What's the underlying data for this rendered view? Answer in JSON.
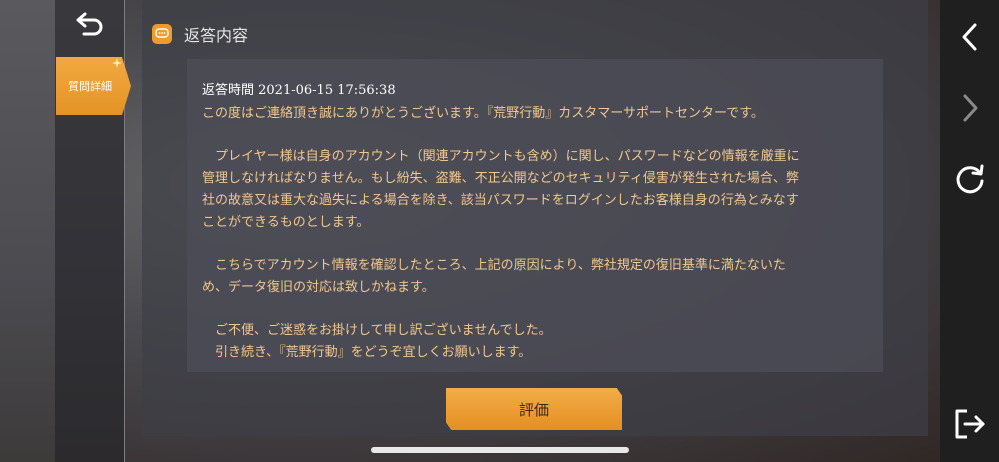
{
  "sidebar": {
    "tab_label": "質問詳細"
  },
  "header": {
    "title": "返答内容"
  },
  "reply": {
    "time": "返答時間 2021-06-15 17:56:38",
    "para1": "この度はご連絡頂き誠にありがとうございます。『荒野行動』カスタマーサポートセンターです。",
    "para2_line1": "　プレイヤー様は自身のアカウント（関連アカウントも含め）に関し、パスワードなどの情報を厳重に",
    "para2_line2": "管理しなければなりません。もし紛失、盗難、不正公開などのセキュリティ侵害が発生された場合、弊",
    "para2_line3": "社の故意又は重大な過失による場合を除き、該当パスワードをログインしたお客様自身の行為とみなす",
    "para2_line4": "ことができるものとします。",
    "para3_line1": "　こちらでアカウント情報を確認したところ、上記の原因により、弊社規定の復旧基準に満たないた",
    "para3_line2": "め、データ復旧の対応は致しかねます。",
    "para4_line1": "　ご不便、ご迷惑をお掛けして申し訳ございませんでした。",
    "para4_line2": "　引き続き、『荒野行動』をどうぞ宜しくお願いします。"
  },
  "actions": {
    "rate_label": "評価"
  },
  "icons": {
    "back": "back-arrow-icon",
    "chat": "chat-bubble-icon",
    "nav_back": "chevron-left-icon",
    "nav_forward": "chevron-right-icon",
    "refresh": "refresh-icon",
    "exit": "exit-icon"
  },
  "colors": {
    "accent": "#e8972a",
    "reply_text": "#f2c88b"
  }
}
